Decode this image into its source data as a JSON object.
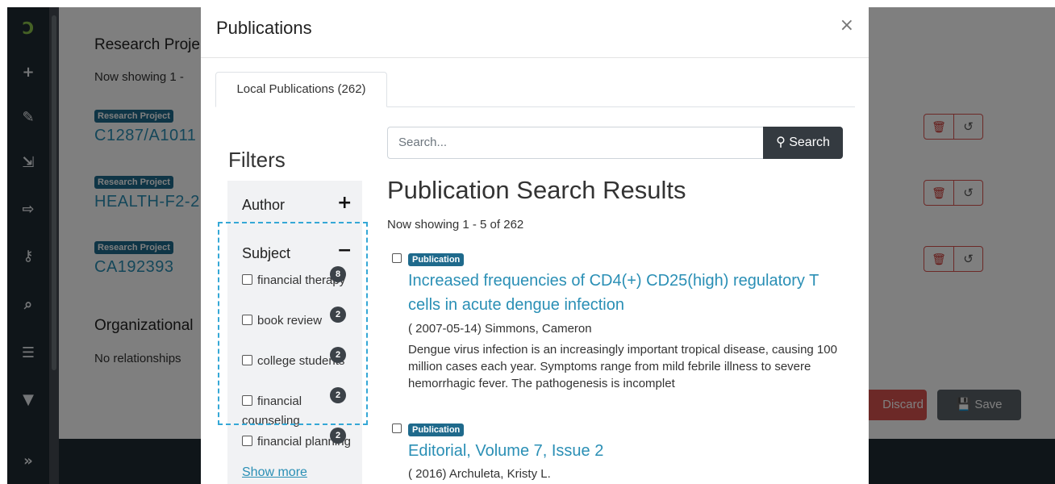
{
  "sidebar": {
    "logo": "Ɔ",
    "icons": [
      {
        "name": "add-icon",
        "glyph": "+"
      },
      {
        "name": "edit-icon",
        "glyph": "✎"
      },
      {
        "name": "import-icon",
        "glyph": "⇲"
      },
      {
        "name": "export-icon",
        "glyph": "⇨"
      },
      {
        "name": "key-icon",
        "glyph": "⚷"
      },
      {
        "name": "search-icon",
        "glyph": "⌕"
      },
      {
        "name": "list-icon",
        "glyph": "☰"
      },
      {
        "name": "filter-icon",
        "glyph": "▼"
      },
      {
        "name": "expand-icon",
        "glyph": "»"
      }
    ]
  },
  "background": {
    "section_title": "Research Proje",
    "now_showing": "Now showing 1 -",
    "projects": [
      {
        "badge": "Research Project",
        "id": "C1287/A1011"
      },
      {
        "badge": "Research Project",
        "id": "HEALTH-F2-2"
      },
      {
        "badge": "Research Project",
        "id": "CA192393"
      }
    ],
    "org_title": "Organizational",
    "no_relationships": "No relationships",
    "delete_icon": "🗑",
    "undo_icon": "↺",
    "discard_label": "Discard",
    "save_label": "Save",
    "save_icon": "💾"
  },
  "modal": {
    "title": "Publications",
    "close": "×",
    "tab_label": "Local Publications (262)",
    "filters_title": "Filters",
    "author_label": "Author",
    "author_toggle": "+",
    "subject_label": "Subject",
    "subject_toggle": "−",
    "subjects": [
      {
        "label": "financial therapy",
        "count": "8"
      },
      {
        "label": "book review",
        "count": "2"
      },
      {
        "label": "college students",
        "count": "2"
      },
      {
        "label": "financial counseling",
        "count": "2"
      },
      {
        "label": "financial planning",
        "count": "2"
      }
    ],
    "show_more": "Show more",
    "search_placeholder": "Search...",
    "search_button": "Search",
    "results_title": "Publication Search Results",
    "results_count": "Now showing 1 - 5 of 262",
    "results": [
      {
        "badge": "Publication",
        "title": "Increased frequencies of CD4(+) CD25(high) regulatory T cells in acute dengue infection",
        "meta": "( 2007-05-14) Simmons, Cameron",
        "abstract": "Dengue virus infection is an increasingly important tropical disease, causing 100 million cases each year. Symptoms range from mild febrile illness to severe hemorrhagic fever. The pathogenesis is incomplet"
      },
      {
        "badge": "Publication",
        "title": "Editorial, Volume 7, Issue 2",
        "meta": "( 2016) Archuleta, Kristy L.",
        "abstract": ""
      }
    ]
  }
}
